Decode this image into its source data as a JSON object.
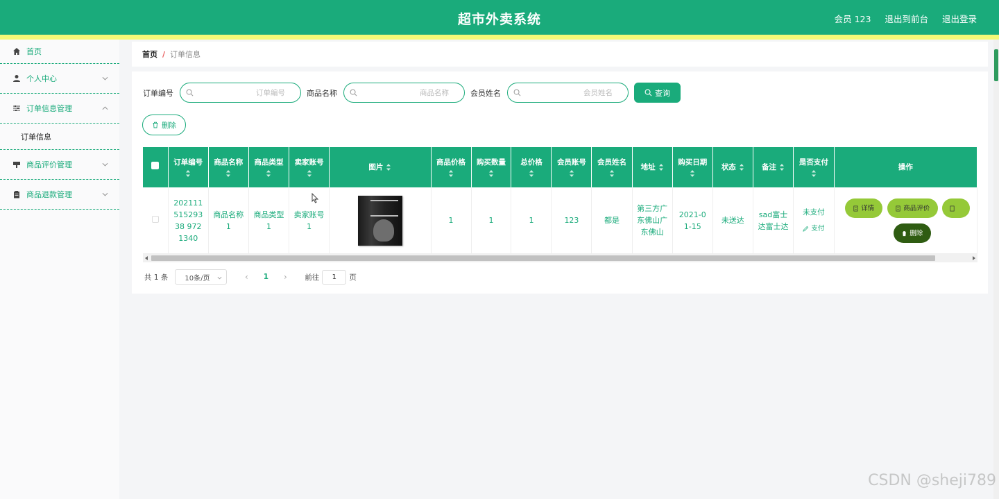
{
  "header": {
    "title": "超市外卖系统",
    "member": "会员 123",
    "front_link": "退出到前台",
    "logout": "退出登录"
  },
  "sidebar": {
    "home": "首页",
    "personal": "个人中心",
    "order_mgmt": "订单信息管理",
    "order_info": "订单信息",
    "review_mgmt": "商品评价管理",
    "refund_mgmt": "商品退款管理"
  },
  "breadcrumb": {
    "home": "首页",
    "separator": "/",
    "current": "订单信息"
  },
  "search": {
    "order_no_label": "订单编号",
    "order_no_placeholder": "订单编号",
    "product_label": "商品名称",
    "product_placeholder": "商品名称",
    "member_label": "会员姓名",
    "member_placeholder": "会员姓名",
    "query_label": "查询"
  },
  "toolbar": {
    "delete_label": "删除"
  },
  "table": {
    "columns": [
      "订单编号",
      "商品名称",
      "商品类型",
      "卖家账号",
      "图片",
      "商品价格",
      "购买数量",
      "总价格",
      "会员账号",
      "会员姓名",
      "地址",
      "购买日期",
      "状态",
      "备注",
      "是否支付",
      "操作"
    ],
    "row": {
      "order_no": "20211151529338 9721340",
      "product_name": "商品名称1",
      "product_type": "商品类型1",
      "seller": "卖家账号1",
      "image_alt": "book-cover",
      "price": "1",
      "quantity": "1",
      "total": "1",
      "member_account": "123",
      "member_name": "都是",
      "address": "第三方广东佛山广东佛山",
      "date": "2021-01-15",
      "status": "未送达",
      "remark": "sad富士达富士达",
      "paid": "未支付",
      "pay_link": "支付",
      "ops": {
        "detail": "详情",
        "review": "商品评价",
        "delete": "删除"
      }
    }
  },
  "pager": {
    "total": "共 1 条",
    "page_size": "10条/页",
    "current_page": "1",
    "goto_label": "前往",
    "goto_value": "1",
    "page_suffix": "页"
  },
  "watermark": "CSDN @sheji789",
  "colors": {
    "primary": "#1aab7b",
    "accent_bar": "#f5f977",
    "op_green": "#95c938",
    "op_dark": "#2f5c12"
  }
}
